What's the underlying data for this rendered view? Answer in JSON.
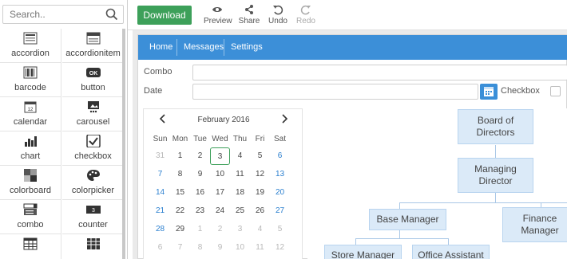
{
  "search": {
    "placeholder": "Search.."
  },
  "widgets": [
    {
      "label": "accordion",
      "icon": "accordion-icon"
    },
    {
      "label": "accordionitem",
      "icon": "accordionitem-icon"
    },
    {
      "label": "barcode",
      "icon": "barcode-icon"
    },
    {
      "label": "button",
      "icon": "button-icon",
      "badge": "OK"
    },
    {
      "label": "calendar",
      "icon": "calendar-icon",
      "badge": "12"
    },
    {
      "label": "carousel",
      "icon": "carousel-icon"
    },
    {
      "label": "chart",
      "icon": "chart-icon"
    },
    {
      "label": "checkbox",
      "icon": "checkbox-icon"
    },
    {
      "label": "colorboard",
      "icon": "colorboard-icon"
    },
    {
      "label": "colorpicker",
      "icon": "colorpicker-icon"
    },
    {
      "label": "combo",
      "icon": "combo-icon"
    },
    {
      "label": "counter",
      "icon": "counter-icon",
      "badge": "3"
    },
    {
      "label": "",
      "icon": "datatable-icon"
    },
    {
      "label": "",
      "icon": "table-icon"
    }
  ],
  "toolbar": {
    "download": "Download",
    "preview": "Preview",
    "share": "Share",
    "undo": "Undo",
    "redo": "Redo"
  },
  "menu": {
    "home": "Home",
    "messages": "Messages",
    "settings": "Settings"
  },
  "form": {
    "combo_label": "Combo",
    "date_label": "Date",
    "checkbox_label": "Checkbox"
  },
  "calendar": {
    "month_title": "February 2016",
    "days_of_week": [
      "Sun",
      "Mon",
      "Tue",
      "Wed",
      "Thu",
      "Fri",
      "Sat"
    ],
    "weeks": [
      [
        "31",
        "1",
        "2",
        "3",
        "4",
        "5",
        "6"
      ],
      [
        "7",
        "8",
        "9",
        "10",
        "11",
        "12",
        "13"
      ],
      [
        "14",
        "15",
        "16",
        "17",
        "18",
        "19",
        "20"
      ],
      [
        "21",
        "22",
        "23",
        "24",
        "25",
        "26",
        "27"
      ],
      [
        "28",
        "29",
        "1",
        "2",
        "3",
        "4",
        "5"
      ],
      [
        "6",
        "7",
        "8",
        "9",
        "10",
        "11",
        "12"
      ]
    ],
    "selected": "3"
  },
  "org": {
    "board": "Board of Directors",
    "managing": "Managing Director",
    "base": "Base Manager",
    "finance": "Finance Manager",
    "store": "Store Manager",
    "office": "Office Assistant"
  },
  "colors": {
    "accent": "#3c8fd8",
    "download_green": "#3da05a",
    "node_fill": "#dbeaf8",
    "weekend_blue": "#2a7fcf"
  }
}
